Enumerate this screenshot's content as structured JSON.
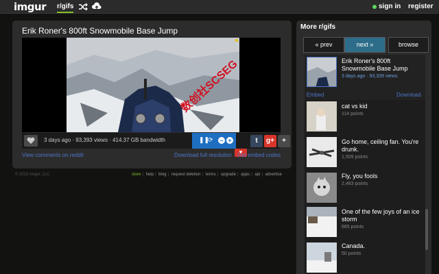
{
  "topbar": {
    "logo": "imgur",
    "section_link": "r/gifs",
    "shuffle_icon": "shuffle-icon",
    "upload_icon": "cloud-upload-icon",
    "sign_in": "sign in",
    "register": "register"
  },
  "post": {
    "title": "Erik Roner's 800ft Snowmobile Base Jump",
    "meta": "3 days ago · 93,393 views · 414.37 GB bandwidth",
    "view_comments": "View comments on reddit",
    "download_full": "Download full resolution",
    "get_embed": "Get embed codes",
    "watermark": "数创社SCSEG"
  },
  "player": {
    "pause_icon": "pause-icon",
    "sync_icon": "sync-icon",
    "minus_label": "–",
    "plus_label": "+"
  },
  "share": {
    "tumblr": "t",
    "gplus": "g+",
    "more": "+"
  },
  "footer": {
    "copyright": "© 2013 Imgur, LLC",
    "links": [
      "store",
      "help",
      "blog",
      "request deletion",
      "terms",
      "upgrade",
      "apps",
      "api",
      "advertise"
    ]
  },
  "sidebar": {
    "title": "More r/gifs",
    "prev": "« prev",
    "next": "next »",
    "browse": "browse",
    "featured": {
      "title": "Erik Roner's 800ft Snowmobile Base Jump",
      "meta": "3 days ago · 93,339 views",
      "embed": "Embed",
      "download": "Download"
    },
    "items": [
      {
        "title": "cat vs kid",
        "points": "114 points"
      },
      {
        "title": "Go home, ceiling fan. You're drunk.",
        "points": "1,509 points"
      },
      {
        "title": "Fly, you fools",
        "points": "2,483 points"
      },
      {
        "title": "One of the few joys of an ice storm",
        "points": "665 points"
      },
      {
        "title": "Canada.",
        "points": "50 points"
      }
    ]
  },
  "colors": {
    "accent_green": "#85bf25",
    "link_blue": "#4e76c9",
    "player_blue": "#1e6fc2",
    "nav_active": "#2e6d8a"
  }
}
